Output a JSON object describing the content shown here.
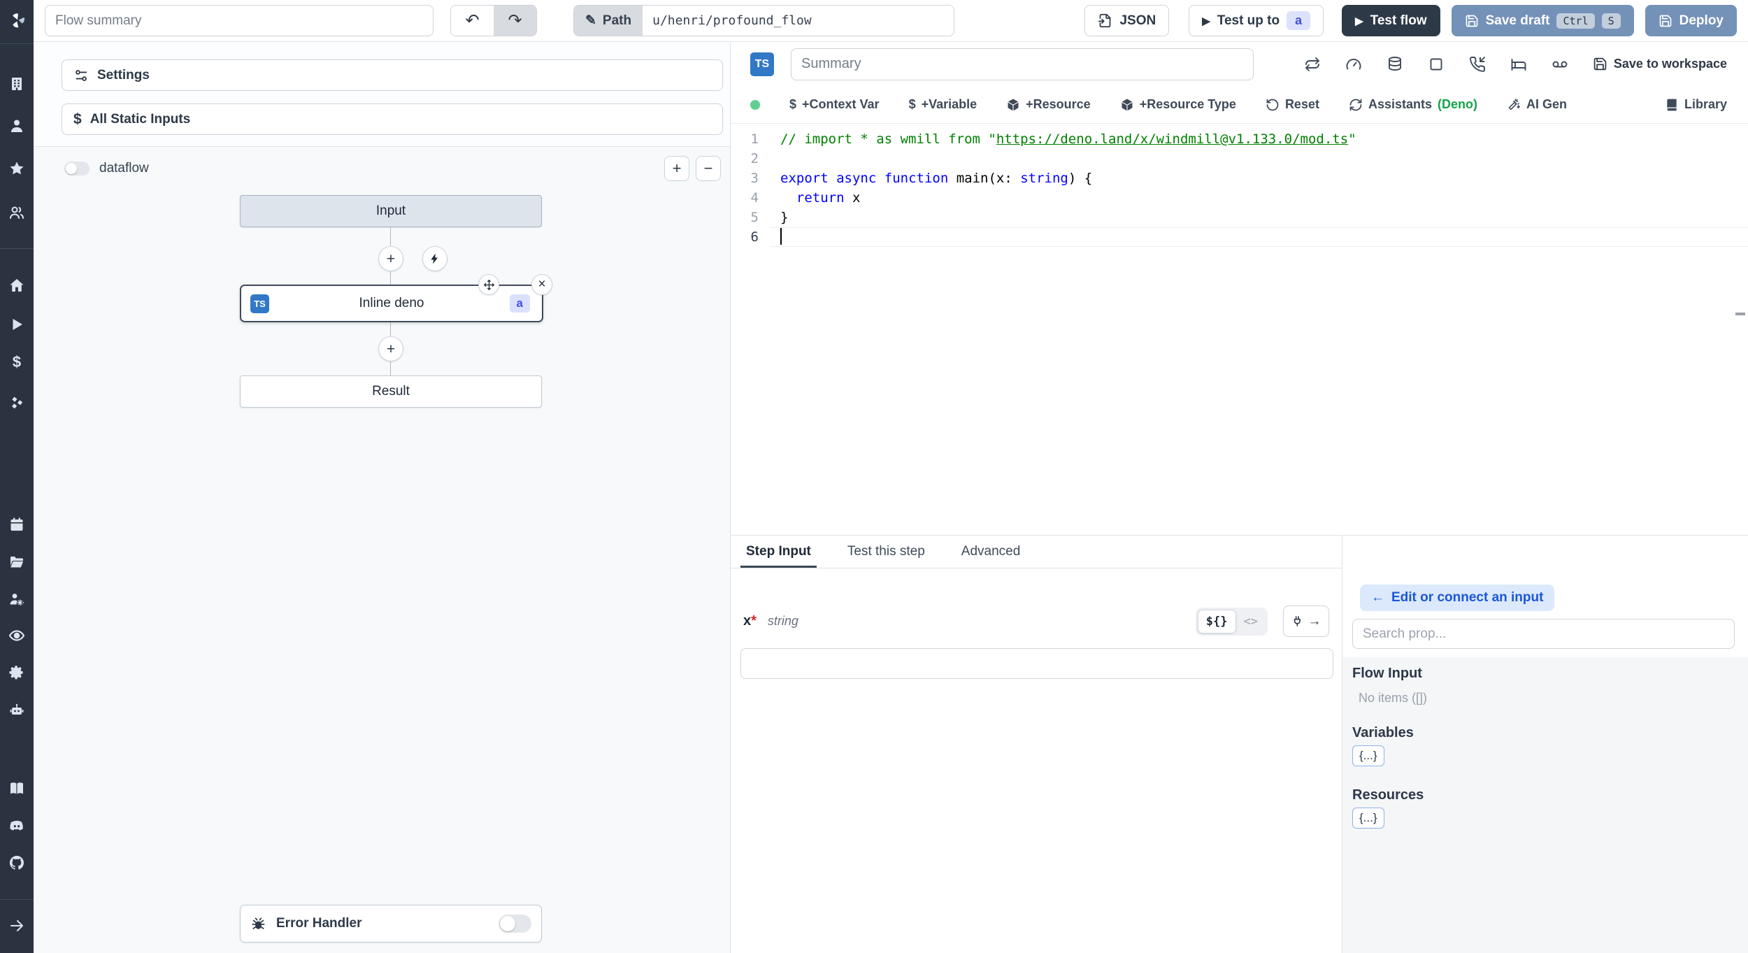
{
  "topbar": {
    "flow_summary_placeholder": "Flow summary",
    "path_label": "Path",
    "path_value": "u/henri/profound_flow",
    "json_button": "JSON",
    "test_up_to": "Test up to",
    "test_up_to_badge": "a",
    "test_flow": "Test flow",
    "save_draft": "Save draft",
    "save_draft_kbd_1": "Ctrl",
    "save_draft_kbd_2": "S",
    "deploy": "Deploy"
  },
  "sidebar": {
    "icons": [
      "windmill-logo",
      "building",
      "user",
      "star",
      "users",
      "home",
      "play",
      "dollar",
      "boxes",
      "calendar",
      "folder",
      "users-cog",
      "eye",
      "gear",
      "bot",
      "book",
      "discord",
      "github",
      "arrow-right"
    ]
  },
  "left_panel": {
    "settings_label": "Settings",
    "all_static_inputs_label": "All Static Inputs",
    "dataflow_label": "dataflow",
    "zoom_in": "+",
    "zoom_out": "−",
    "nodes": {
      "input": "Input",
      "step_label": "Inline deno",
      "step_lang": "TS",
      "step_badge": "a",
      "result": "Result"
    },
    "error_handler_label": "Error Handler"
  },
  "editor": {
    "lang_badge": "TS",
    "summary_placeholder": "Summary",
    "save_to_workspace": "Save to workspace",
    "toolbar": {
      "context_var": "+Context Var",
      "variable": "+Variable",
      "resource": "+Resource",
      "resource_type": "+Resource Type",
      "reset": "Reset",
      "assistants": "Assistants",
      "assistants_lang": "(Deno)",
      "ai_gen": "AI Gen",
      "library": "Library",
      "dollar_glyph": "$"
    },
    "code": {
      "lines": [
        {
          "num": "1",
          "tokens": [
            {
              "text": "// import * as wmill from \"",
              "type": "comment"
            },
            {
              "text": "https://deno.land/x/windmill@v1.133.0/mod.ts",
              "type": "comment-link"
            },
            {
              "text": "\"",
              "type": "comment"
            }
          ]
        },
        {
          "num": "2",
          "tokens": []
        },
        {
          "num": "3",
          "tokens": [
            {
              "text": "export",
              "type": "keyword"
            },
            {
              "text": " ",
              "type": "plain"
            },
            {
              "text": "async",
              "type": "keyword"
            },
            {
              "text": " ",
              "type": "plain"
            },
            {
              "text": "function",
              "type": "keyword"
            },
            {
              "text": " main(x: ",
              "type": "plain"
            },
            {
              "text": "string",
              "type": "keyword"
            },
            {
              "text": ") {",
              "type": "plain"
            }
          ]
        },
        {
          "num": "4",
          "tokens": [
            {
              "text": "  ",
              "type": "plain"
            },
            {
              "text": "return",
              "type": "keyword"
            },
            {
              "text": " x",
              "type": "plain"
            }
          ]
        },
        {
          "num": "5",
          "tokens": [
            {
              "text": "}",
              "type": "plain"
            }
          ]
        },
        {
          "num": "6",
          "tokens": [],
          "cursor": true,
          "active": true
        }
      ]
    }
  },
  "bottom": {
    "tabs": [
      "Step Input",
      "Test this step",
      "Advanced"
    ],
    "field_name": "x",
    "field_required": "*",
    "field_type": "string",
    "expr_toggle": "${}",
    "code_toggle": "<>",
    "input_value": ""
  },
  "connect_panel": {
    "back_button": "Edit or connect an input",
    "search_placeholder": "Search prop...",
    "flow_input_title": "Flow Input",
    "flow_input_empty": "No items ([])",
    "variables_title": "Variables",
    "variables_button": "{...}",
    "resources_title": "Resources",
    "resources_button": "{...}"
  },
  "colors": {
    "accent_blue": "#3178c6",
    "steel_button": "#7491b8",
    "dark_button": "#2e3947",
    "indigo_badge_bg": "#dde2fc",
    "indigo_badge_text": "#4353d9",
    "deno_green": "#16a34a",
    "status_dot_green": "#5fcf8f",
    "link_blue": "#1a56db"
  }
}
